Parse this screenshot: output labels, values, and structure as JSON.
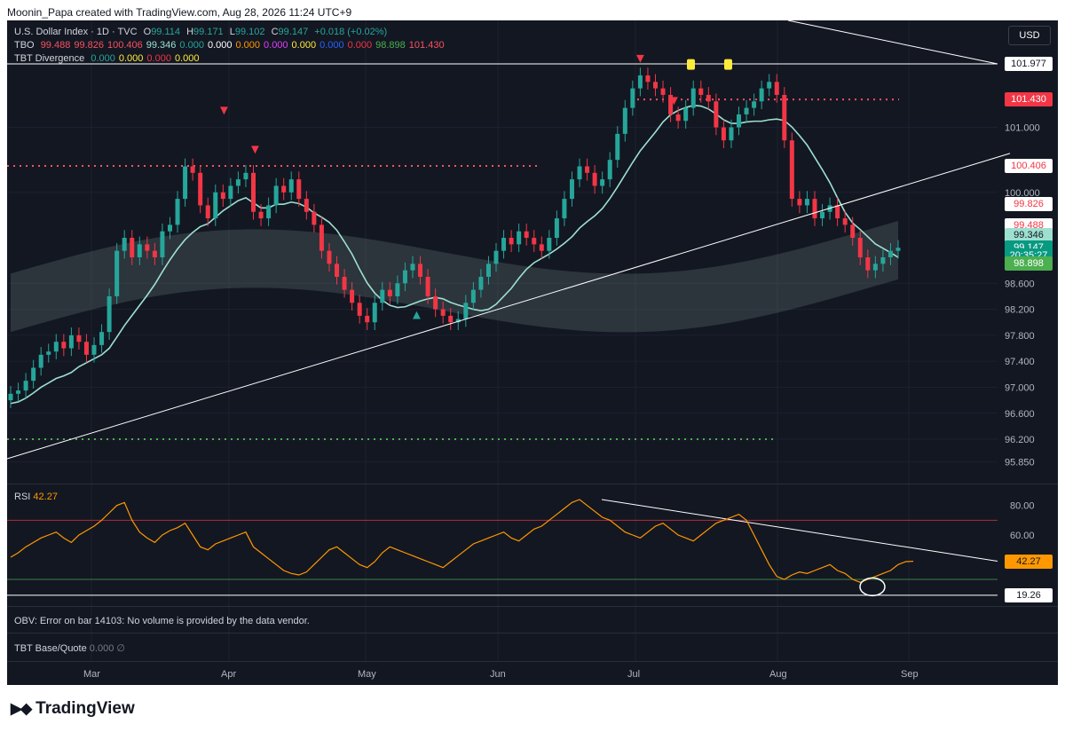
{
  "header": {
    "credit": "Moonin_Papa created with TradingView.com, Aug 28, 2026 11:24 UTC+9"
  },
  "brand": {
    "name": "TradingView"
  },
  "symbol": {
    "title": "U.S. Dollar Index · 1D · TVC",
    "open_label": "O",
    "open": "99.114",
    "high_label": "H",
    "high": "99.171",
    "low_label": "L",
    "low": "99.102",
    "close_label": "C",
    "close": "99.147",
    "change": "+0.018 (+0.02%)"
  },
  "currency_button": "USD",
  "tbo": {
    "name": "TBO",
    "values": [
      {
        "v": "99.488",
        "color": "#f7525f"
      },
      {
        "v": "99.826",
        "color": "#f7525f"
      },
      {
        "v": "100.406",
        "color": "#f7525f"
      },
      {
        "v": "99.346",
        "color": "#9de0d0"
      },
      {
        "v": "0.000",
        "color": "#26a69a"
      },
      {
        "v": "0.000",
        "color": "#ffffff"
      },
      {
        "v": "0.000",
        "color": "#ff9800"
      },
      {
        "v": "0.000",
        "color": "#e040fb"
      },
      {
        "v": "0.000",
        "color": "#ffeb3b"
      },
      {
        "v": "0.000",
        "color": "#2962ff"
      },
      {
        "v": "0.000",
        "color": "#f23645"
      },
      {
        "v": "98.898",
        "color": "#4caf50"
      },
      {
        "v": "101.430",
        "color": "#f7525f"
      }
    ]
  },
  "divergence": {
    "name": "TBT Divergence",
    "values": [
      {
        "v": "0.000",
        "color": "#26a69a"
      },
      {
        "v": "0.000",
        "color": "#ffeb3b"
      },
      {
        "v": "0.000",
        "color": "#f23645"
      },
      {
        "v": "0.000",
        "color": "#ffeb3b"
      }
    ]
  },
  "price_axis_ticks": [
    "101.000",
    "100.000",
    "98.600",
    "98.200",
    "97.800",
    "97.400",
    "97.000",
    "96.600",
    "96.200",
    "95.850"
  ],
  "price_tags": [
    {
      "v": "101.977",
      "bg": "#ffffff",
      "fg": "#131722",
      "price": 101.977
    },
    {
      "v": "101.430",
      "bg": "#f23645",
      "fg": "#ffffff",
      "price": 101.43
    },
    {
      "v": "100.406",
      "bg": "#ffffff",
      "fg": "#f23645",
      "price": 100.406
    },
    {
      "v": "99.826",
      "bg": "#ffffff",
      "fg": "#f23645",
      "price": 99.826
    },
    {
      "v": "99.488",
      "bg": "#ffffff",
      "fg": "#f23645",
      "price": 99.488
    },
    {
      "v": "99.346",
      "bg": "#9de0d0",
      "fg": "#131722",
      "price": 99.346
    },
    {
      "v": "99.147",
      "bg": "#089981",
      "fg": "#ffffff",
      "price": 99.147
    },
    {
      "v": "20:35:27",
      "bg": "#089981",
      "fg": "#ffffff",
      "price": 99.03
    },
    {
      "v": "98.898",
      "bg": "#4caf50",
      "fg": "#ffffff",
      "price": 98.898
    }
  ],
  "rsi": {
    "name": "RSI",
    "value": "42.27",
    "axis_ticks": [
      "80.00",
      "60.00"
    ],
    "last_tag": "42.27",
    "line_tag": "19.26",
    "upper_band": 70,
    "lower_band": 30
  },
  "obv": {
    "text": "OBV: Error on bar 14103: No volume is provided by the data vendor."
  },
  "base_quote": {
    "name": "TBT Base/Quote",
    "value": "0.000",
    "extra": "∅"
  },
  "time_axis": [
    "Mar",
    "Apr",
    "May",
    "Jun",
    "Jul",
    "Aug",
    "Sep"
  ],
  "chart_data": {
    "type": "candlestick",
    "symbol": "U.S. Dollar Index",
    "timeframe": "1D",
    "months": [
      "Mar",
      "Apr",
      "May",
      "Jun",
      "Jul",
      "Aug",
      "Sep"
    ],
    "price_range": [
      95.85,
      101.977
    ],
    "closes": [
      96.9,
      96.95,
      97.1,
      97.3,
      97.5,
      97.55,
      97.7,
      97.6,
      97.8,
      97.7,
      97.5,
      97.65,
      97.85,
      98.4,
      99.1,
      99.3,
      99.0,
      99.2,
      99.1,
      99.0,
      99.4,
      99.5,
      99.9,
      100.4,
      100.3,
      99.8,
      99.6,
      100.0,
      99.9,
      100.1,
      100.2,
      100.3,
      99.7,
      99.6,
      99.8,
      100.1,
      100.0,
      100.2,
      99.9,
      99.7,
      99.5,
      99.1,
      98.9,
      98.7,
      98.5,
      98.3,
      98.1,
      98.0,
      98.3,
      98.5,
      98.4,
      98.6,
      98.8,
      98.9,
      98.7,
      98.4,
      98.2,
      98.1,
      98.0,
      98.05,
      98.3,
      98.5,
      98.7,
      98.9,
      99.1,
      99.3,
      99.2,
      99.4,
      99.3,
      99.2,
      99.1,
      99.3,
      99.6,
      99.9,
      100.2,
      100.4,
      100.3,
      100.1,
      100.2,
      100.5,
      100.9,
      101.3,
      101.6,
      101.8,
      101.7,
      101.6,
      101.5,
      101.2,
      101.1,
      101.3,
      101.6,
      101.5,
      101.4,
      101.0,
      100.8,
      101.0,
      101.2,
      101.3,
      101.4,
      101.6,
      101.7,
      101.5,
      100.8,
      99.9,
      99.8,
      99.9,
      99.6,
      99.7,
      99.8,
      99.6,
      99.5,
      99.3,
      99.0,
      98.8,
      98.9,
      99.0,
      99.1,
      99.147
    ],
    "rsi_values": [
      45,
      48,
      52,
      55,
      58,
      60,
      62,
      58,
      55,
      60,
      63,
      66,
      70,
      75,
      80,
      82,
      70,
      62,
      58,
      55,
      60,
      63,
      65,
      68,
      60,
      52,
      50,
      54,
      56,
      58,
      60,
      62,
      52,
      48,
      44,
      40,
      36,
      34,
      33,
      35,
      40,
      45,
      50,
      52,
      48,
      44,
      40,
      38,
      42,
      48,
      52,
      50,
      48,
      46,
      44,
      42,
      40,
      38,
      42,
      46,
      50,
      54,
      56,
      58,
      60,
      62,
      58,
      56,
      60,
      64,
      66,
      70,
      74,
      78,
      82,
      84,
      80,
      76,
      72,
      70,
      66,
      62,
      60,
      58,
      62,
      66,
      68,
      64,
      60,
      58,
      56,
      60,
      64,
      68,
      70,
      72,
      74,
      70,
      60,
      50,
      40,
      32,
      30,
      33,
      35,
      34,
      36,
      38,
      40,
      36,
      34,
      30,
      28,
      30,
      32,
      34,
      36,
      40,
      42,
      42.27
    ],
    "trendlines": [
      {
        "name": "ascending support",
        "from": [
          "Mar-start",
          95.9
        ],
        "to": [
          "Sep-end",
          100.6
        ]
      },
      {
        "name": "descending resistance",
        "from": [
          "Jul",
          102.6
        ],
        "to": [
          "Sep-end",
          101.977
        ]
      }
    ],
    "levels": [
      {
        "name": "resistance",
        "price": 101.43,
        "color": "#f7525f"
      },
      {
        "name": "resistance",
        "price": 100.406,
        "color": "#f7525f"
      },
      {
        "name": "support",
        "price": 96.2,
        "color": "#4caf50"
      }
    ]
  }
}
